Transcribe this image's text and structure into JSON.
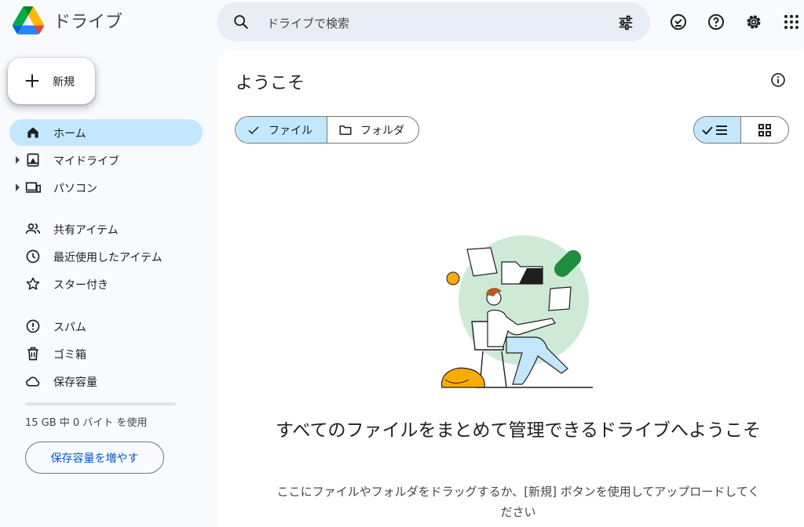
{
  "header": {
    "app_name": "ドライブ",
    "search_placeholder": "ドライブで検索",
    "icons": [
      "search-icon",
      "tune-icon",
      "offline-ready-icon",
      "help-icon",
      "settings-icon",
      "apps-grid-icon"
    ]
  },
  "sidebar": {
    "new_label": "新規",
    "items": [
      {
        "label": "ホーム",
        "icon": "home-icon",
        "active": true
      },
      {
        "label": "マイドライブ",
        "icon": "my-drive-icon"
      },
      {
        "label": "パソコン",
        "icon": "computers-icon"
      },
      {
        "label": "共有アイテム",
        "icon": "shared-icon"
      },
      {
        "label": "最近使用したアイテム",
        "icon": "recent-icon"
      },
      {
        "label": "スター付き",
        "icon": "star-icon"
      },
      {
        "label": "スパム",
        "icon": "spam-icon"
      },
      {
        "label": "ゴミ箱",
        "icon": "trash-icon"
      },
      {
        "label": "保存容量",
        "icon": "cloud-icon"
      }
    ],
    "storage_text": "15 GB 中 0 バイト を使用",
    "storage_used_fraction": 0,
    "storage_button": "保存容量を増やす"
  },
  "main": {
    "title": "ようこそ",
    "filters": [
      {
        "label": "ファイル",
        "selected": true
      },
      {
        "label": "フォルダ",
        "selected": false
      }
    ],
    "view_mode": "list",
    "welcome_title": "すべてのファイルをまとめて管理できるドライブへようこそ",
    "welcome_text": "ここにファイルやフォルダをドラッグするか、[新規] ボタンを使用してアップロードしてください"
  },
  "colors": {
    "accent_blue": "#0b57d0",
    "selected_bg": "#c2e7ff",
    "search_bg": "#e9eef6",
    "page_bg": "#f8fafd",
    "illustration_green": "#ceead6"
  }
}
